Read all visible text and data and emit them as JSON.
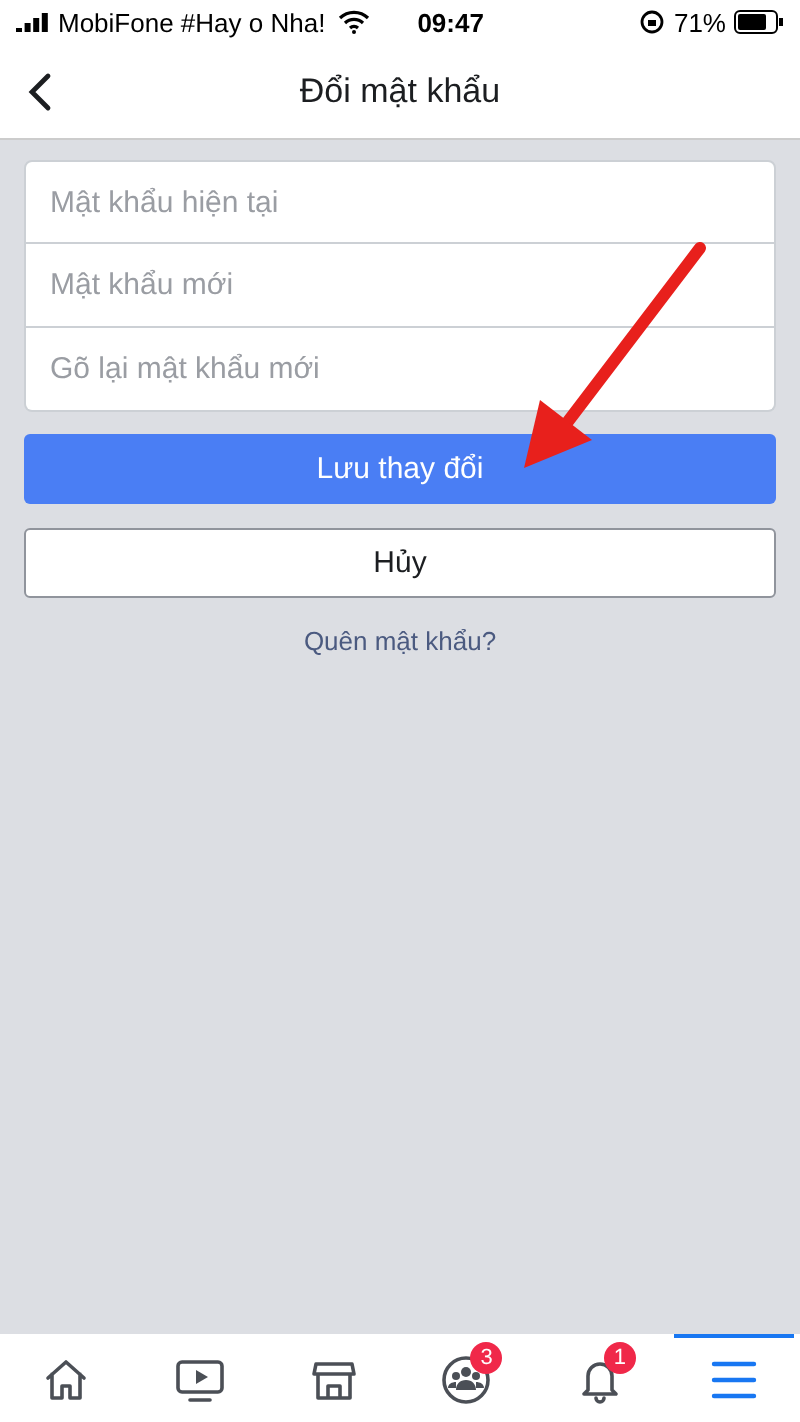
{
  "status_bar": {
    "carrier": "MobiFone #Hay o Nha!",
    "time": "09:47",
    "battery": "71%"
  },
  "header": {
    "title": "Đổi mật khẩu"
  },
  "form": {
    "fields": [
      {
        "placeholder": "Mật khẩu hiện tại"
      },
      {
        "placeholder": "Mật khẩu mới"
      },
      {
        "placeholder": "Gõ lại mật khẩu mới"
      }
    ],
    "save_button": "Lưu thay đổi",
    "cancel_button": "Hủy",
    "forgot_link": "Quên mật khẩu?"
  },
  "tab_bar": [
    {
      "kind": "home",
      "selected": false
    },
    {
      "kind": "video",
      "selected": false
    },
    {
      "kind": "marketplace",
      "selected": false
    },
    {
      "kind": "groups",
      "selected": false,
      "badge": "3"
    },
    {
      "kind": "notifications",
      "selected": false,
      "badge": "1"
    },
    {
      "kind": "menu",
      "selected": true
    }
  ]
}
